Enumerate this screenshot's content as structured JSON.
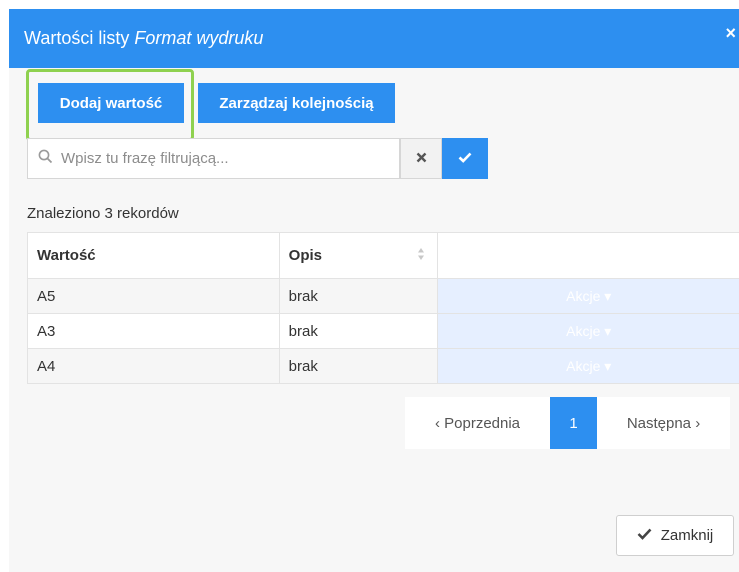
{
  "dialog": {
    "title_prefix": "Wartości listy",
    "title_italic": "Format wydruku",
    "close_symbol": "×"
  },
  "toolbar": {
    "add_label": "Dodaj wartość",
    "order_label": "Zarządzaj kolejnością"
  },
  "search": {
    "placeholder": "Wpisz tu frazę filtrującą...",
    "value": "",
    "icon": "search-icon",
    "clear_icon": "clear-icon",
    "confirm_icon": "check-icon"
  },
  "records_text": "Znaleziono 3 rekordów",
  "table": {
    "headers": [
      "Wartość",
      "Opis",
      ""
    ],
    "rows": [
      {
        "value": "A5",
        "desc": "brak",
        "action": "Akcje ▾"
      },
      {
        "value": "A3",
        "desc": "brak",
        "action": "Akcje ▾"
      },
      {
        "value": "A4",
        "desc": "brak",
        "action": "Akcje ▾"
      }
    ]
  },
  "pagination": {
    "prev_label": "‹ Poprzednia",
    "current_page": "1",
    "next_label": "Następna ›"
  },
  "footer": {
    "close_label": "Zamknij"
  },
  "colors": {
    "primary": "#2d8ff0",
    "highlight": "#8fd14f",
    "action_cell": "#e6efff"
  }
}
